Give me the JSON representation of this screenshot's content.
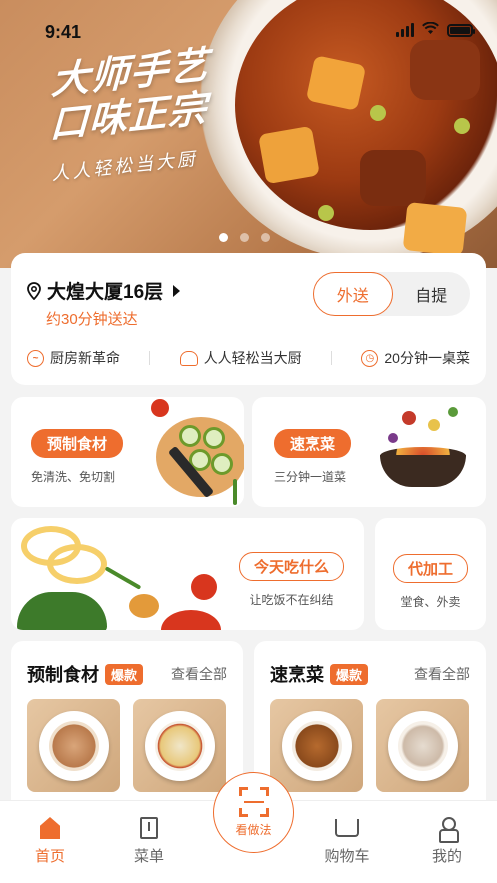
{
  "status_bar": {
    "time": "9:41"
  },
  "hero": {
    "title_line1": "大师手艺",
    "title_line2": "口味正宗",
    "subtitle": "人人轻松当大厨",
    "carousel_pages": 3,
    "carousel_active": 1
  },
  "location": {
    "address": "大煌大厦16层",
    "eta": "约30分钟送达",
    "modes": [
      "外送",
      "自提"
    ],
    "active_mode": "外送",
    "features": [
      "厨房新革命",
      "人人轻松当大厨",
      "20分钟一桌菜"
    ]
  },
  "promos": [
    {
      "title": "预制食材",
      "subtitle": "免清洗、免切割"
    },
    {
      "title": "速烹菜",
      "subtitle": "三分钟一道菜"
    },
    {
      "title": "今天吃什么",
      "subtitle": "让吃饭不在纠结"
    },
    {
      "title": "代加工",
      "subtitle": "堂食、外卖"
    }
  ],
  "sections": [
    {
      "title": "预制食材",
      "badge": "爆款",
      "more": "查看全部"
    },
    {
      "title": "速烹菜",
      "badge": "爆款",
      "more": "查看全部"
    }
  ],
  "tabbar": {
    "items": [
      "首页",
      "菜单",
      "购物车",
      "我的"
    ],
    "scan_label": "看做法",
    "active": "首页"
  },
  "colors": {
    "accent": "#ee6d2e",
    "background": "#f3f3f3"
  }
}
